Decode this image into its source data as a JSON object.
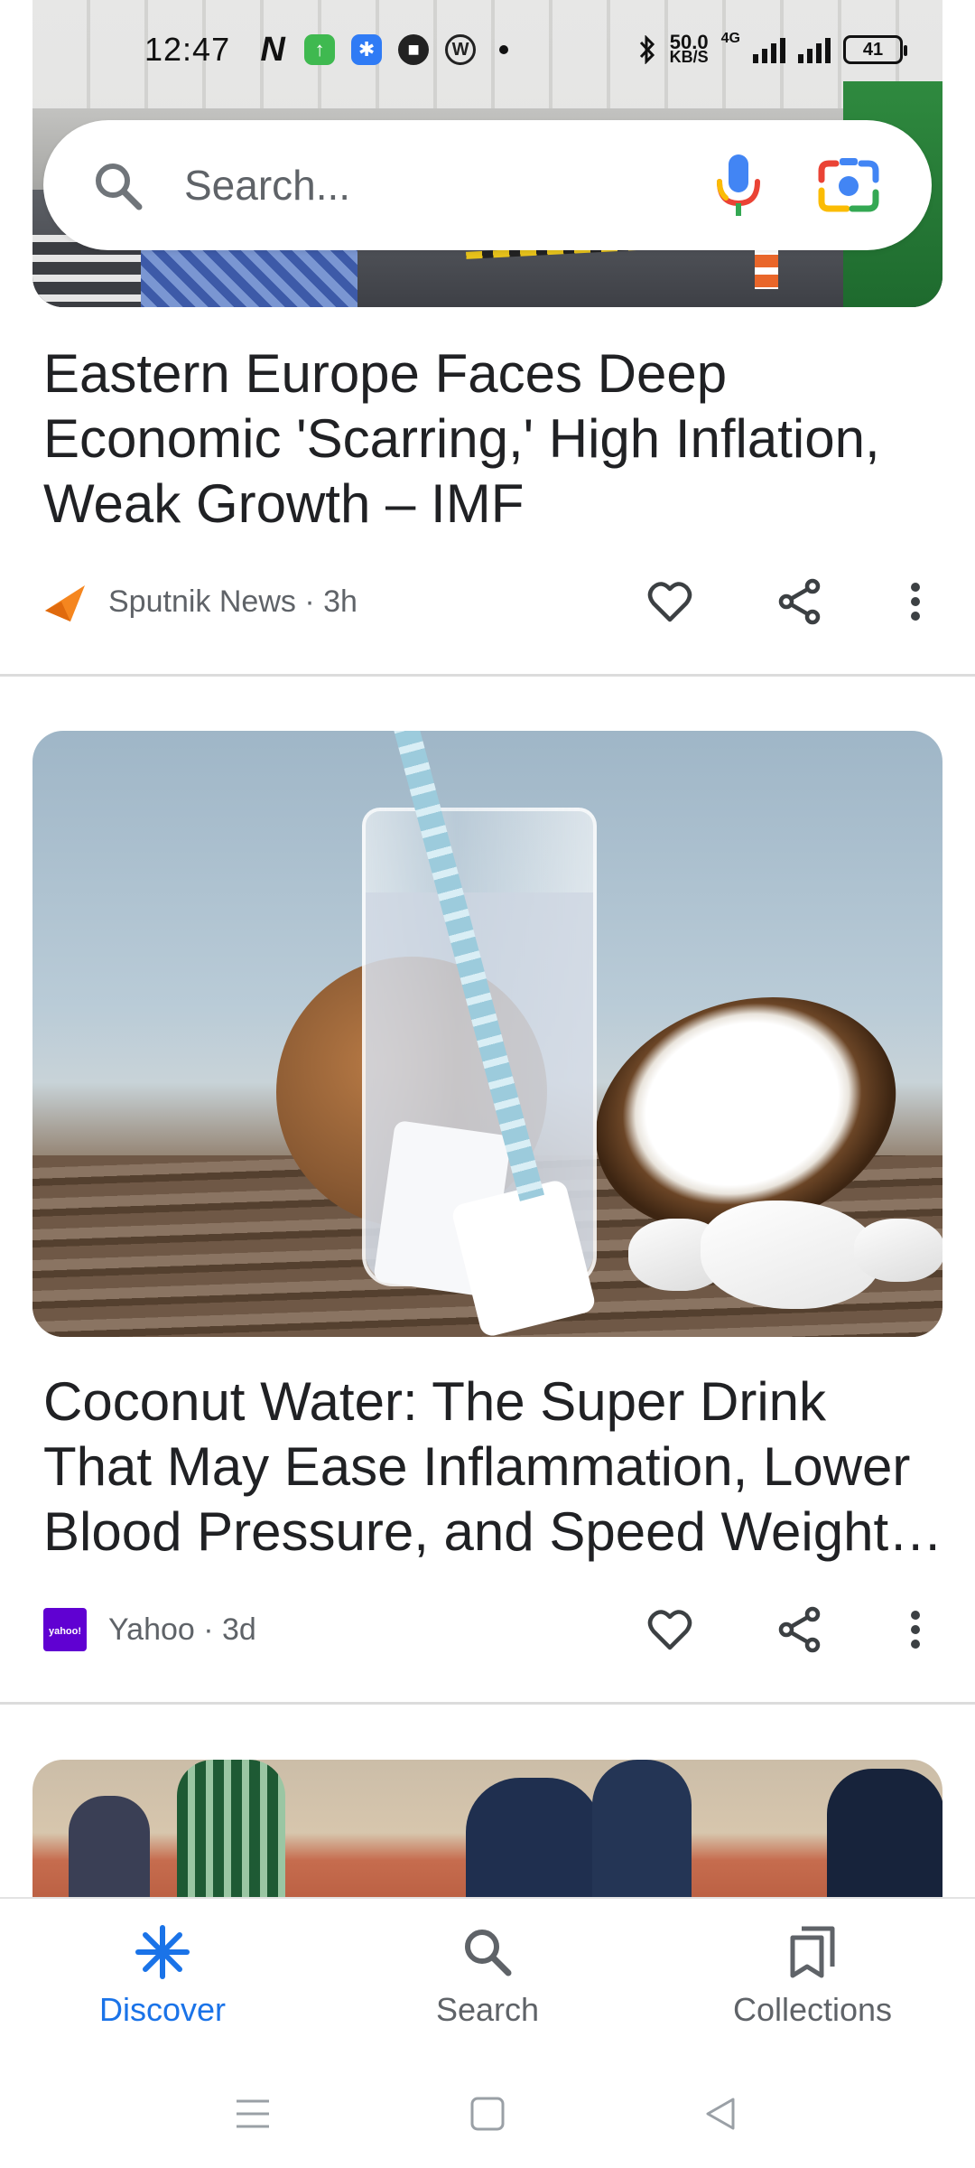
{
  "status_bar": {
    "time": "12:47",
    "net_speed_value": "50.0",
    "net_speed_unit": "KB/S",
    "network_type": "4G",
    "battery_level": "41",
    "notification_icons": [
      "n-app-icon",
      "green-upload-icon",
      "bluetooth-app-icon",
      "red-app-icon",
      "wordpress-icon",
      "more-dot-icon"
    ]
  },
  "search": {
    "placeholder": "Search..."
  },
  "articles": [
    {
      "title": "Eastern Europe Faces Deep Economic 'Scarring,' High Inflation, Weak Growth – IMF",
      "source": "Sputnik News",
      "age": "3h",
      "meta": "Sputnik News · 3h",
      "logo_color": "#f5861f"
    },
    {
      "title": "Coconut Water: The Super Drink That May Ease Inflammation, Lower Blood Pressure, and Speed Weight Loss",
      "source": "Yahoo",
      "age": "3d",
      "meta": "Yahoo · 3d",
      "logo_color": "#6001d2",
      "logo_text": "yahoo!"
    }
  ],
  "bottom_nav": {
    "items": [
      {
        "label": "Discover",
        "icon": "asterisk-icon",
        "active": true
      },
      {
        "label": "Search",
        "icon": "search-icon",
        "active": false
      },
      {
        "label": "Collections",
        "icon": "collections-icon",
        "active": false
      }
    ]
  },
  "colors": {
    "accent": "#1a73e8",
    "text_primary": "#202124",
    "text_secondary": "#5f6368",
    "mic_blue": "#4285f4",
    "mic_red": "#ea4335",
    "lens_yellow": "#fbbc04",
    "lens_green": "#34a853"
  }
}
